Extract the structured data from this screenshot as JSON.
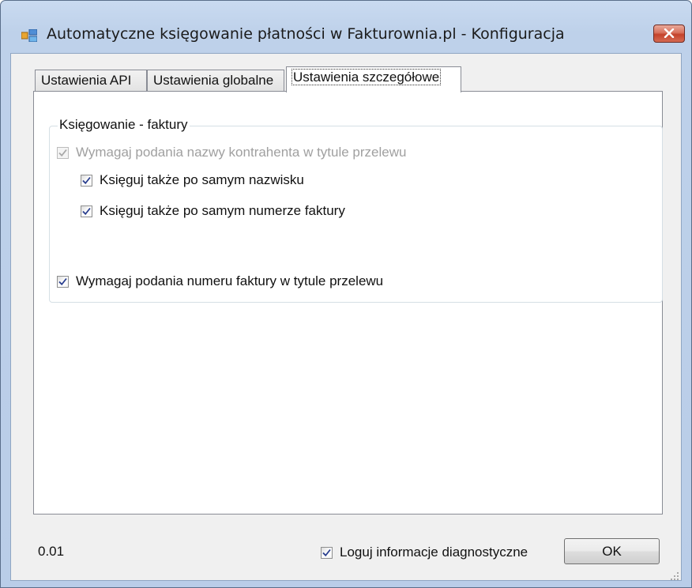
{
  "window": {
    "title": "Automatyczne księgowanie płatności w Fakturownia.pl - Konfiguracja",
    "app_icon": "app-window-icon",
    "close_icon": "close-icon"
  },
  "tabs": [
    {
      "label": "Ustawienia API",
      "active": false
    },
    {
      "label": "Ustawienia globalne",
      "active": false
    },
    {
      "label": "Ustawienia szczegółowe",
      "active": true
    }
  ],
  "group": {
    "legend": "Księgowanie - faktury",
    "options": [
      {
        "label": "Wymagaj podania nazwy kontrahenta w tytule przelewu",
        "checked": true,
        "enabled": false
      },
      {
        "label": "Księguj także po samym nazwisku",
        "checked": true,
        "enabled": true
      },
      {
        "label": "Księguj także po samym numerze faktury",
        "checked": true,
        "enabled": true
      },
      {
        "label": "Wymagaj podania numeru faktury w tytule przelewu",
        "checked": true,
        "enabled": true
      }
    ]
  },
  "footer": {
    "version": "0.01",
    "diagnostics_label": "Loguj informacje diagnostyczne",
    "diagnostics_checked": true,
    "ok_label": "OK"
  },
  "colors": {
    "title_bar": "#bed1ea",
    "close_button": "#c4422b",
    "check_mark": "#2a3f8f",
    "check_mark_disabled": "#a8a8a8"
  }
}
